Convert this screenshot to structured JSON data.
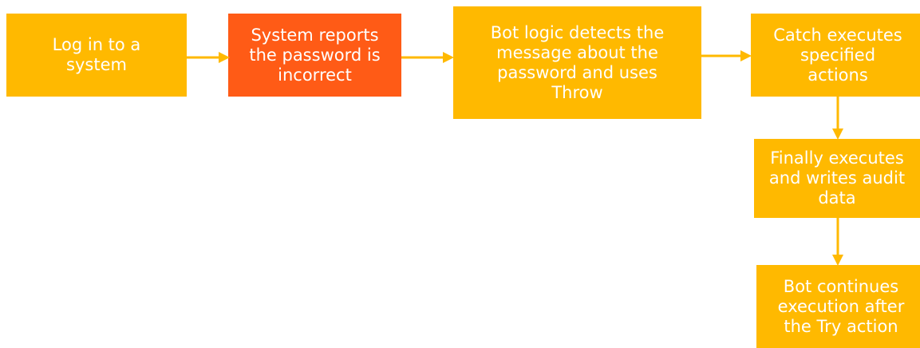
{
  "colors": {
    "step": "#FFB900",
    "error": "#FF5B16",
    "arrow": "#FFB900",
    "text": "#FFFFFF"
  },
  "nodes": [
    {
      "id": "log-in",
      "label": "Log in to a\nsystem"
    },
    {
      "id": "password-incorrect",
      "label": "System reports\nthe password is\nincorrect"
    },
    {
      "id": "throw",
      "label": "Bot logic detects the\nmessage about the\npassword and uses\nThrow"
    },
    {
      "id": "catch",
      "label": "Catch executes\nspecified\nactions"
    },
    {
      "id": "finally",
      "label": "Finally executes\nand writes audit\ndata"
    },
    {
      "id": "continue",
      "label": "Bot continues\nexecution after\nthe Try action"
    }
  ],
  "edges": [
    {
      "from": "log-in",
      "to": "password-incorrect"
    },
    {
      "from": "password-incorrect",
      "to": "throw"
    },
    {
      "from": "throw",
      "to": "catch"
    },
    {
      "from": "catch",
      "to": "finally"
    },
    {
      "from": "finally",
      "to": "continue"
    }
  ]
}
